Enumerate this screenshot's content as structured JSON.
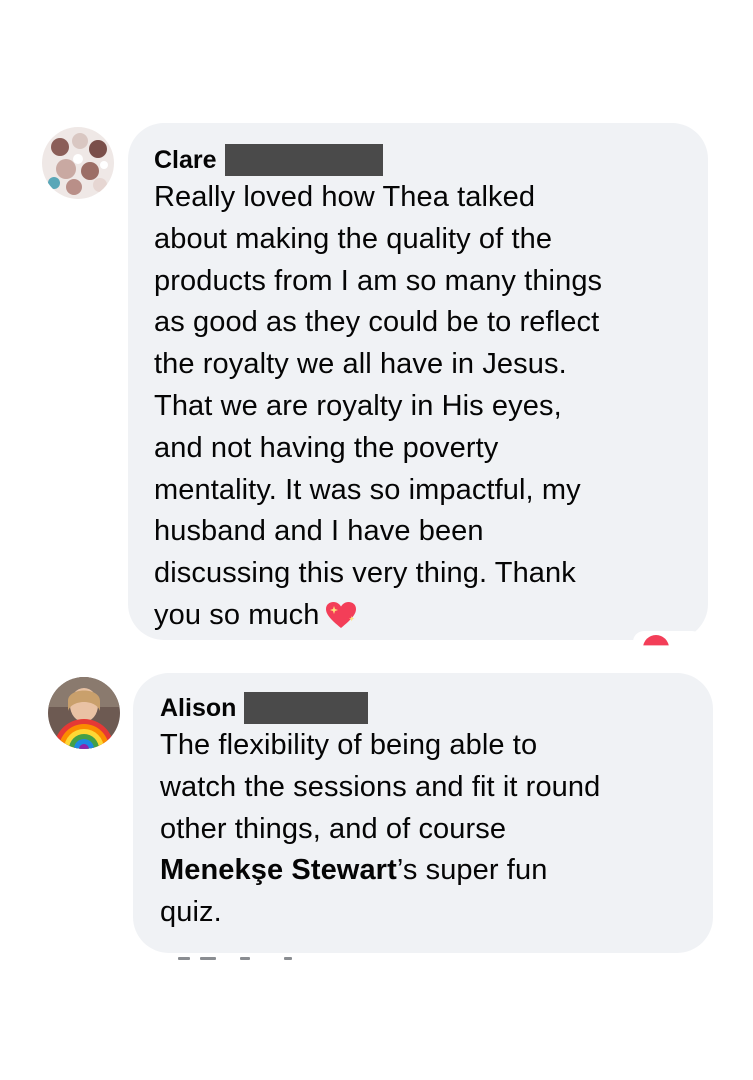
{
  "comments": [
    {
      "author": "Clare",
      "author_surname_redacted": true,
      "text_lines": [
        "Really loved how Thea talked",
        "about making the quality of the",
        "products from I am so many things",
        "as good as they could be to reflect",
        "the royalty we all have in Jesus.",
        "That we are royalty in His eyes,",
        "and not having the poverty",
        "mentality. It was so impactful, my",
        "husband and I have been",
        "discussing this very thing. Thank",
        "you so much"
      ],
      "trailing_emoji": "sparkling-heart-icon",
      "avatar": "avatar-clare"
    },
    {
      "author": "Alison",
      "author_surname_redacted": true,
      "text_lines": [
        "The flexibility of being able to",
        "watch the sessions and fit it round",
        "other things, and of course"
      ],
      "mention": "Menekşe Stewart",
      "mention_suffix": "’s super fun",
      "final_line": "quiz.",
      "avatar": "avatar-alison"
    }
  ],
  "colors": {
    "bubble_bg": "#f0f2f5",
    "text": "#050505",
    "redaction": "#4a4a4a",
    "heart": "#f33e58"
  }
}
